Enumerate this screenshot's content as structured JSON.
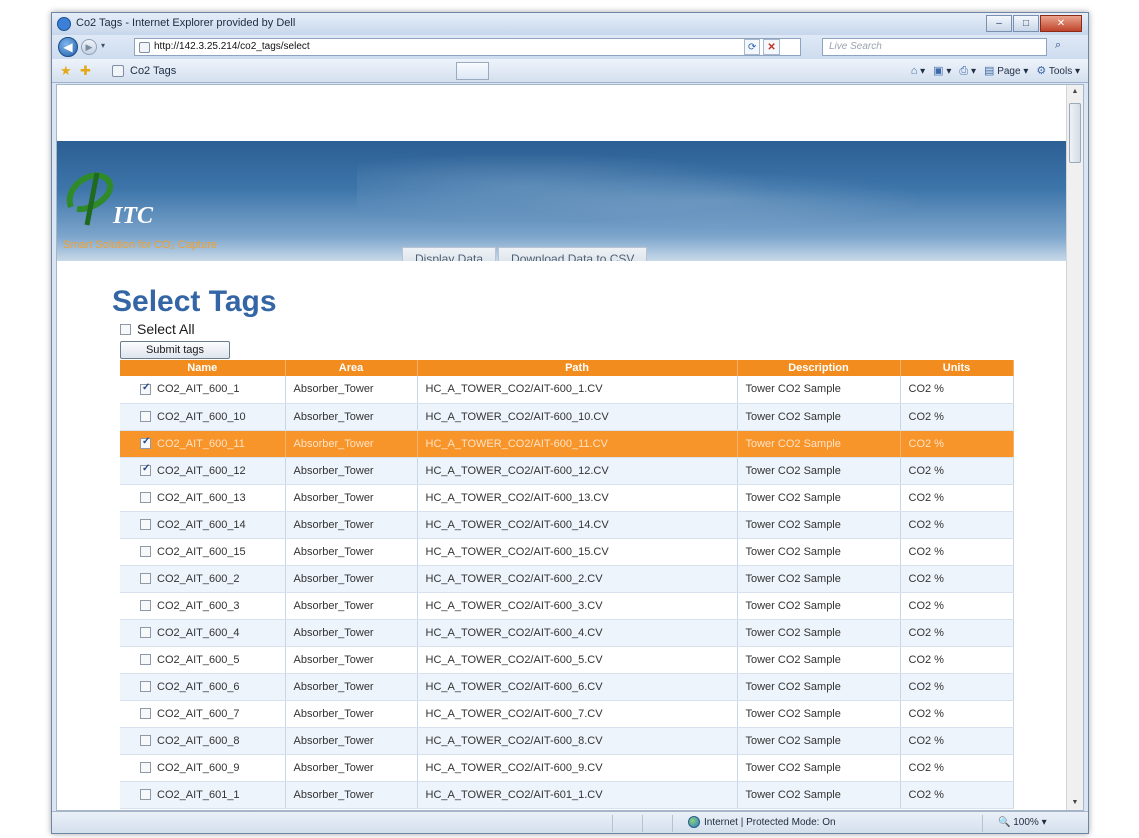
{
  "window": {
    "title": "Co2 Tags - Internet Explorer provided by Dell",
    "controls": {
      "minimize": "–",
      "maximize": "□",
      "close": "✕"
    }
  },
  "addressbar": {
    "url": "http://142.3.25.214/co2_tags/select",
    "search_placeholder": "Live Search",
    "refresh_glyph": "⟳",
    "stop_glyph": "✕",
    "search_glyph": "⌕"
  },
  "tabbar": {
    "tab_title": "Co2 Tags",
    "commands": [
      {
        "glyph": "⌂",
        "label": "▾"
      },
      {
        "glyph": "▣",
        "label": "▾"
      },
      {
        "glyph": "⎙",
        "label": "▾"
      },
      {
        "glyph": "▤",
        "label": "Page ▾"
      },
      {
        "glyph": "⚙",
        "label": "Tools ▾"
      }
    ]
  },
  "banner": {
    "logo_text": "ITC",
    "tagline": "Smart Solution for CO₂ Capture",
    "nav": [
      "Display Data",
      "Download Data to CSV"
    ],
    "colors": {
      "accent": "#f0a02e",
      "banner": "#3d75aa"
    }
  },
  "page": {
    "title": "Select Tags",
    "select_all_label": "Select All",
    "submit_label": "Submit tags"
  },
  "table": {
    "columns": [
      "Name",
      "Area",
      "Path",
      "Description",
      "Units"
    ],
    "header_color": "#f28c1f",
    "rows": [
      {
        "checked": true,
        "selected": false,
        "name": "CO2_AIT_600_1",
        "area": "Absorber_Tower",
        "path": "HC_A_TOWER_CO2/AIT-600_1.CV",
        "description": "Tower CO2 Sample",
        "units": "CO2 %"
      },
      {
        "checked": false,
        "selected": false,
        "name": "CO2_AIT_600_10",
        "area": "Absorber_Tower",
        "path": "HC_A_TOWER_CO2/AIT-600_10.CV",
        "description": "Tower CO2 Sample",
        "units": "CO2 %"
      },
      {
        "checked": true,
        "selected": true,
        "name": "CO2_AIT_600_11",
        "area": "Absorber_Tower",
        "path": "HC_A_TOWER_CO2/AIT-600_11.CV",
        "description": "Tower CO2 Sample",
        "units": "CO2 %"
      },
      {
        "checked": true,
        "selected": false,
        "name": "CO2_AIT_600_12",
        "area": "Absorber_Tower",
        "path": "HC_A_TOWER_CO2/AIT-600_12.CV",
        "description": "Tower CO2 Sample",
        "units": "CO2 %"
      },
      {
        "checked": false,
        "selected": false,
        "name": "CO2_AIT_600_13",
        "area": "Absorber_Tower",
        "path": "HC_A_TOWER_CO2/AIT-600_13.CV",
        "description": "Tower CO2 Sample",
        "units": "CO2 %"
      },
      {
        "checked": false,
        "selected": false,
        "name": "CO2_AIT_600_14",
        "area": "Absorber_Tower",
        "path": "HC_A_TOWER_CO2/AIT-600_14.CV",
        "description": "Tower CO2 Sample",
        "units": "CO2 %"
      },
      {
        "checked": false,
        "selected": false,
        "name": "CO2_AIT_600_15",
        "area": "Absorber_Tower",
        "path": "HC_A_TOWER_CO2/AIT-600_15.CV",
        "description": "Tower CO2 Sample",
        "units": "CO2 %"
      },
      {
        "checked": false,
        "selected": false,
        "name": "CO2_AIT_600_2",
        "area": "Absorber_Tower",
        "path": "HC_A_TOWER_CO2/AIT-600_2.CV",
        "description": "Tower CO2 Sample",
        "units": "CO2 %"
      },
      {
        "checked": false,
        "selected": false,
        "name": "CO2_AIT_600_3",
        "area": "Absorber_Tower",
        "path": "HC_A_TOWER_CO2/AIT-600_3.CV",
        "description": "Tower CO2 Sample",
        "units": "CO2 %"
      },
      {
        "checked": false,
        "selected": false,
        "name": "CO2_AIT_600_4",
        "area": "Absorber_Tower",
        "path": "HC_A_TOWER_CO2/AIT-600_4.CV",
        "description": "Tower CO2 Sample",
        "units": "CO2 %"
      },
      {
        "checked": false,
        "selected": false,
        "name": "CO2_AIT_600_5",
        "area": "Absorber_Tower",
        "path": "HC_A_TOWER_CO2/AIT-600_5.CV",
        "description": "Tower CO2 Sample",
        "units": "CO2 %"
      },
      {
        "checked": false,
        "selected": false,
        "name": "CO2_AIT_600_6",
        "area": "Absorber_Tower",
        "path": "HC_A_TOWER_CO2/AIT-600_6.CV",
        "description": "Tower CO2 Sample",
        "units": "CO2 %"
      },
      {
        "checked": false,
        "selected": false,
        "name": "CO2_AIT_600_7",
        "area": "Absorber_Tower",
        "path": "HC_A_TOWER_CO2/AIT-600_7.CV",
        "description": "Tower CO2 Sample",
        "units": "CO2 %"
      },
      {
        "checked": false,
        "selected": false,
        "name": "CO2_AIT_600_8",
        "area": "Absorber_Tower",
        "path": "HC_A_TOWER_CO2/AIT-600_8.CV",
        "description": "Tower CO2 Sample",
        "units": "CO2 %"
      },
      {
        "checked": false,
        "selected": false,
        "name": "CO2_AIT_600_9",
        "area": "Absorber_Tower",
        "path": "HC_A_TOWER_CO2/AIT-600_9.CV",
        "description": "Tower CO2 Sample",
        "units": "CO2 %"
      },
      {
        "checked": false,
        "selected": false,
        "name": "CO2_AIT_601_1",
        "area": "Absorber_Tower",
        "path": "HC_A_TOWER_CO2/AIT-601_1.CV",
        "description": "Tower CO2 Sample",
        "units": "CO2 %"
      }
    ]
  },
  "statusbar": {
    "zone": "Internet | Protected Mode: On",
    "zoom": "100%",
    "zoom_glyph": "▾"
  }
}
